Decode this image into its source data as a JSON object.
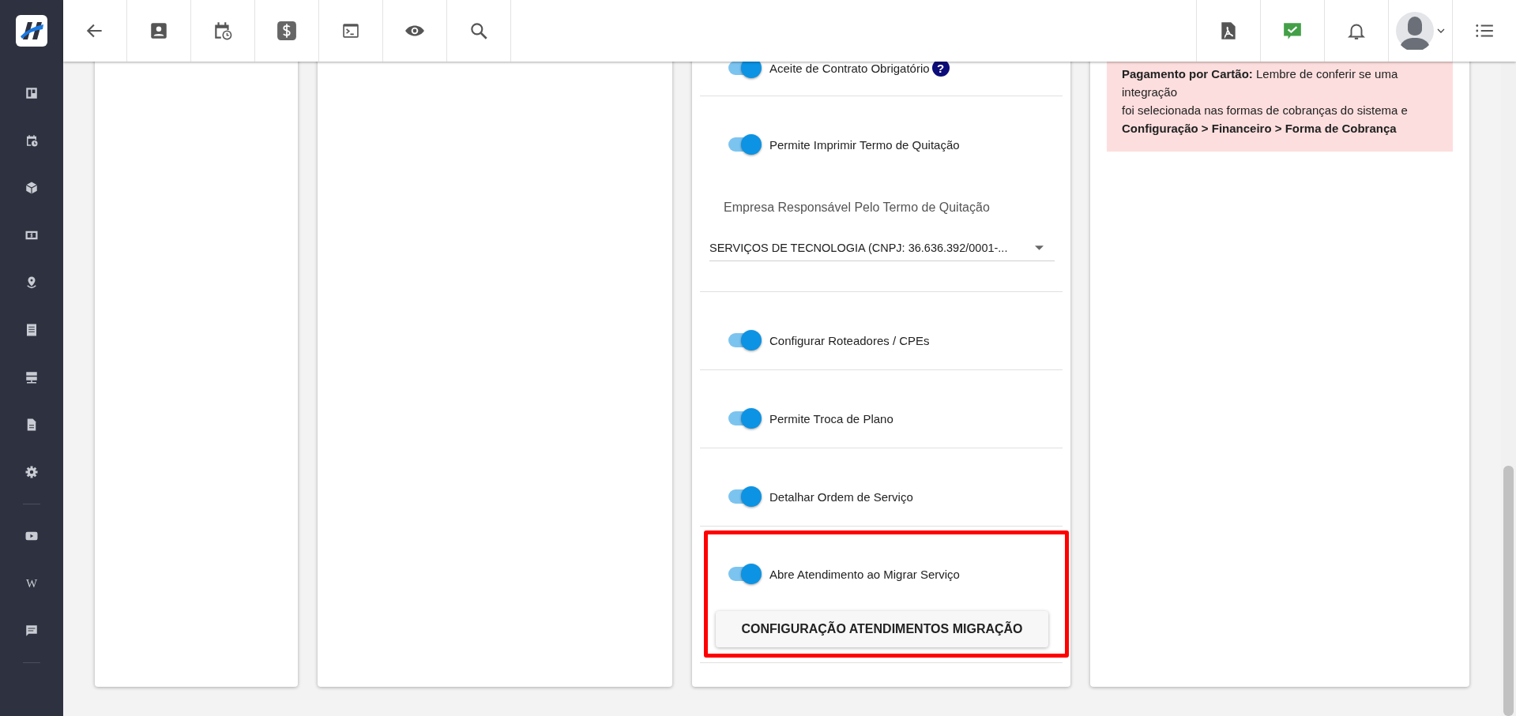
{
  "sidebar": {
    "wiki_link": "W"
  },
  "settings_card": {
    "sections": [
      {
        "highlighted": false,
        "items": [
          {
            "kind": "toggle",
            "label": "Aceite de Contrato Obrigatório",
            "on": true,
            "help": "?"
          }
        ]
      },
      {
        "highlighted": false,
        "items": [
          {
            "kind": "toggle",
            "label": "Permite Imprimir Termo de Quitação",
            "on": true
          },
          {
            "kind": "select",
            "label": "Empresa Responsável Pelo Termo de Quitação",
            "value": "SERVIÇOS DE TECNOLOGIA (CNPJ: 36.636.392/0001-..."
          }
        ]
      },
      {
        "highlighted": false,
        "items": [
          {
            "kind": "toggle",
            "label": "Configurar Roteadores / CPEs",
            "on": true
          }
        ]
      },
      {
        "highlighted": false,
        "items": [
          {
            "kind": "toggle",
            "label": "Permite Troca de Plano",
            "on": true
          }
        ]
      },
      {
        "highlighted": false,
        "items": [
          {
            "kind": "toggle",
            "label": "Detalhar Ordem de Serviço",
            "on": true
          }
        ]
      },
      {
        "highlighted": true,
        "items": [
          {
            "kind": "toggle",
            "label": "Abre Atendimento ao Migrar Serviço",
            "on": true
          },
          {
            "kind": "button",
            "label": "CONFIGURAÇÃO ATENDIMENTOS MIGRAÇÃO"
          }
        ]
      }
    ]
  },
  "alert": {
    "lines": [
      "**Pagamento por Cartão:** Lembre de conferir se uma",
      "integração",
      "foi selecionada nas formas de cobranças do sistema e",
      "**Configuração > Financeiro > Forma de Cobrança**"
    ]
  }
}
